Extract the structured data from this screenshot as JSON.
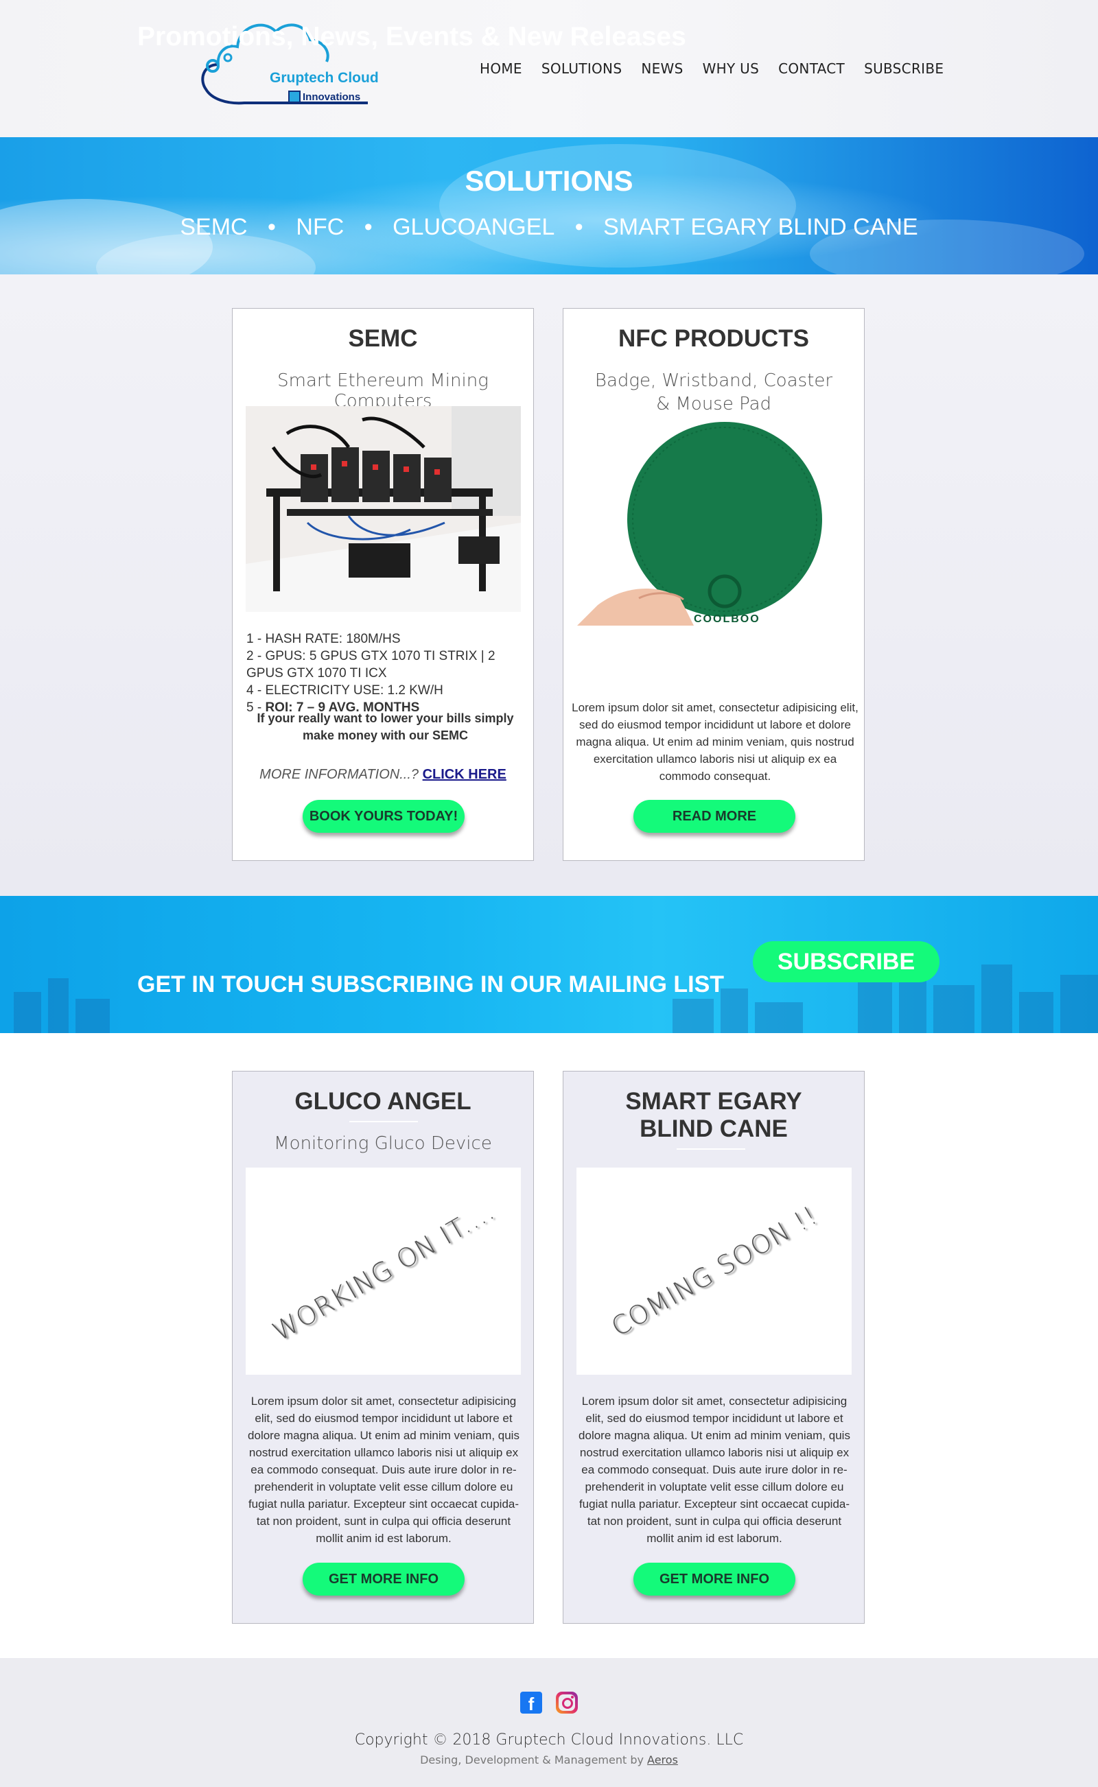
{
  "header": {
    "logo": {
      "line1": "Gruptech Cloud",
      "line2": "Innovations"
    },
    "nav": [
      "HOME",
      "SOLUTIONS",
      "NEWS",
      "WHY US",
      "CONTACT",
      "SUBSCRIBE"
    ]
  },
  "solutions_banner": {
    "title": "SOLUTIONS",
    "links": [
      "SEMC",
      "NFC",
      "GLUCOANGEL",
      "SMART EGARY BLIND CANE"
    ],
    "separator": "•"
  },
  "semc_card": {
    "title": "SEMC",
    "subtitle": "Smart Ethereum Mining Computers",
    "specs": [
      "1 - HASH RATE: 180M/HS",
      "2 - GPUS: 5 GPUS GTX 1070 TI STRIX | 2 GPUS GTX 1070 TI ICX",
      "4 - ELECTRICITY USE: 1.2 KW/H"
    ],
    "roi_prefix": "5 - ",
    "roi_value": "ROI: 7 – 9 AVG. MONTHS",
    "pitch": "If  your really want to lower your bills simply make money with our SEMC",
    "more_label": "MORE INFORMATION...? ",
    "more_link": "CLICK HERE",
    "button": "BOOK YOURS TODAY!"
  },
  "nfc_card": {
    "title": "NFC PRODUCTS",
    "subtitle_line1": "Badge, Wristband, Coaster",
    "subtitle_line2": "& Mouse Pad",
    "coaster_brand": "COOLBOO",
    "body": "Lorem ipsum dolor sit amet, consectetur adipisicing elit, sed do eiusmod tempor incididunt ut labore et dolore magna aliqua. Ut enim ad minim veniam, quis nostrud exercitation ullamco laboris nisi ut aliquip ex ea commodo consequat.",
    "button": "READ MORE"
  },
  "promo_banner": {
    "headline": "Promotions, News, Events & New Releases",
    "subline": "GET IN TOUCH SUBSCRIBING IN OUR MAILING LIST",
    "button": "SUBSCRIBE"
  },
  "gluco_card": {
    "title": "GLUCO ANGEL",
    "subtitle": "Monitoring Gluco Device",
    "placeholder": "WORKING ON IT....",
    "body": "Lorem ipsum dolor sit amet, consectetur adipisicing elit, sed do eiusmod tempor incididunt ut labore et dolore magna aliqua. Ut enim ad minim veniam, quis nostrud exercitation ullamco laboris nisi ut aliquip ex ea commodo consequat. Duis aute irure dolor in re-prehenderit in voluptate velit esse cillum dolore eu fugiat nulla pariatur. Excepteur sint occaecat cupida-tat non proident, sunt in culpa qui officia deserunt mollit anim id est laborum.",
    "button": "GET MORE INFO"
  },
  "cane_card": {
    "title_line1": "SMART EGARY",
    "title_line2": "BLIND CANE",
    "placeholder": "COMING SOON !!",
    "body": "Lorem ipsum dolor sit amet, consectetur adipisicing elit, sed do eiusmod tempor incididunt ut labore et dolore magna aliqua. Ut enim ad minim veniam, quis nostrud exercitation ullamco laboris nisi ut aliquip ex ea commodo consequat. Duis aute irure dolor in re-prehenderit in voluptate velit esse cillum dolore eu fugiat nulla pariatur. Excepteur sint occaecat cupida-tat non proident, sunt in culpa qui officia deserunt mollit anim id est laborum.",
    "button": "GET MORE INFO"
  },
  "footer": {
    "social": [
      "facebook-icon",
      "instagram-icon"
    ],
    "copyright": "Copyright © 2018 Gruptech Cloud Innovations. LLC",
    "credits_prefix": "Desing, Development & Management by ",
    "credits_link": "Aeros"
  },
  "colors": {
    "accent_green": "#14fa7a",
    "banner_blue": "#1fb0f0",
    "link_navy": "#1a1a8a"
  }
}
